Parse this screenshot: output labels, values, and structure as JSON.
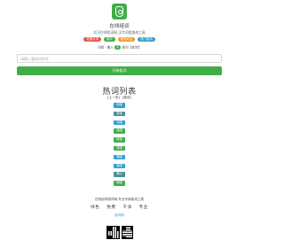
{
  "site": {
    "title": "在线组词",
    "tagline_prefix": "组词",
    "tagline_text": "在线组词网,汉字词组查询工具"
  },
  "tags": [
    {
      "label": "热搜字词",
      "color": "#e8534a"
    },
    {
      "label": "组词",
      "color": "#3fae49"
    },
    {
      "label": "组词大全",
      "color": "#f09a2a"
    },
    {
      "label": "热门组词",
      "color": "#2f9fd0"
    }
  ],
  "switcher": {
    "prefix": "词组 · 输入",
    "pill": "字",
    "suffix": "组词【查询】"
  },
  "search": {
    "placeholder": "请输入要组词的字",
    "button_label": "开始组词"
  },
  "hot_list": {
    "heading": "热词列表",
    "sub_links": [
      "[上一页]",
      "[首页]"
    ],
    "words": [
      {
        "label": "消组",
        "color": "#2f9fd0"
      },
      {
        "label": "肃组",
        "color": "#4a8c9c"
      },
      {
        "label": "浏组",
        "color": "#2f9fd0"
      },
      {
        "label": "潇组",
        "color": "#3fae49"
      },
      {
        "label": "桥组",
        "color": "#3fae49"
      },
      {
        "label": "诱组",
        "color": "#3fae49"
      },
      {
        "label": "潮组",
        "color": "#2f9fd0"
      },
      {
        "label": "凑组",
        "color": "#2f9fd0"
      },
      {
        "label": "满心",
        "color": "#4a8c9c"
      },
      {
        "label": "帽组",
        "color": "#3fae49"
      }
    ]
  },
  "footer": {
    "description": "在线组词组词网,专业专用组词工具",
    "values": [
      "绿色",
      "免费",
      "干净",
      "专业"
    ],
    "link": "组词网"
  }
}
